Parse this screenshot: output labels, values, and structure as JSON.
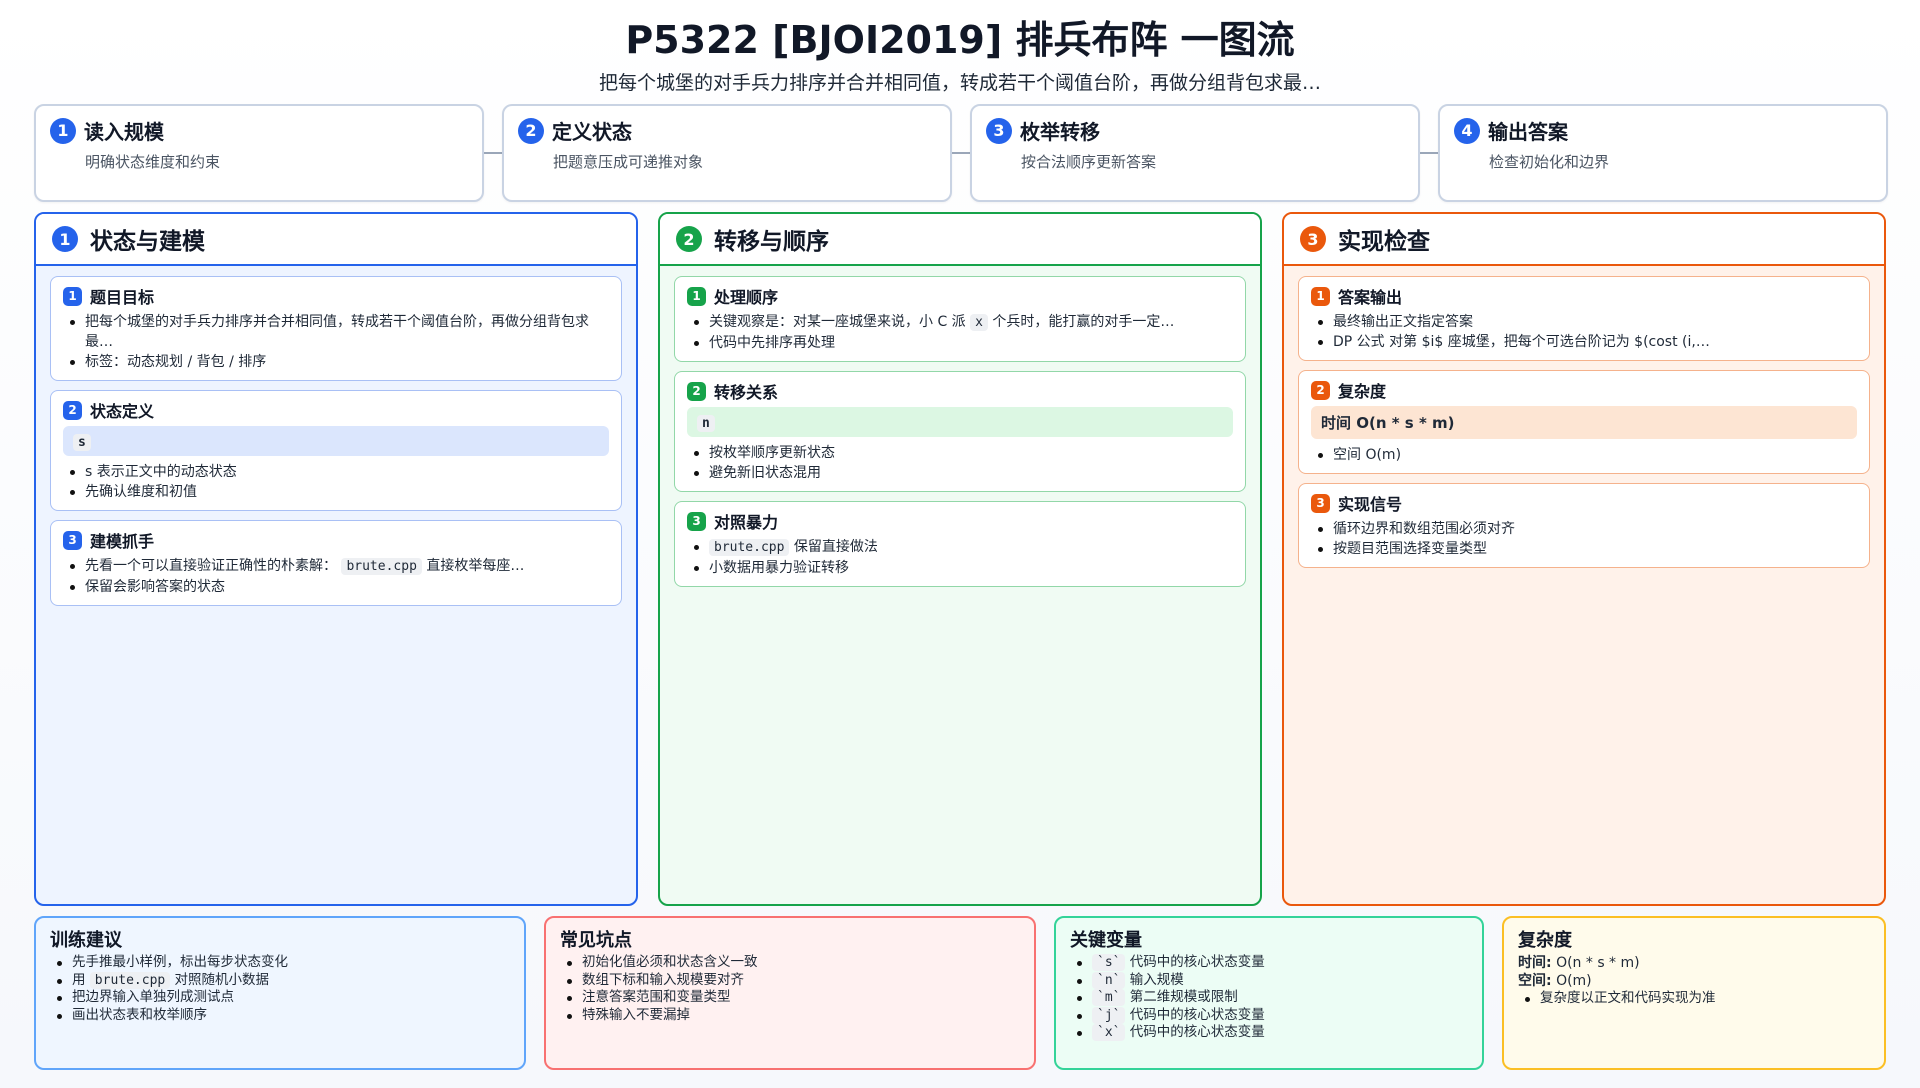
{
  "header": {
    "title": "P5322 [BJOI2019] 排兵布阵 一图流",
    "subtitle": "把每个城堡的对手兵力排序并合并相同值，转成若干个阈值台阶，再做分组背包求最…"
  },
  "steps": [
    {
      "num": "1",
      "title": "读入规模",
      "desc": "明确状态维度和约束"
    },
    {
      "num": "2",
      "title": "定义状态",
      "desc": "把题意压成可递推对象"
    },
    {
      "num": "3",
      "title": "枚举转移",
      "desc": "按合法顺序更新答案"
    },
    {
      "num": "4",
      "title": "输出答案",
      "desc": "检查初始化和边界"
    }
  ],
  "columns": {
    "model": {
      "num": "1",
      "title": "状态与建模",
      "cards": {
        "goal": {
          "num": "1",
          "title": "题目目标",
          "items": [
            "把每个城堡的对手兵力排序并合并相同值，转成若干个阈值台阶，再做分组背包求最…",
            "标签：动态规划 / 背包 / 排序"
          ]
        },
        "state": {
          "num": "2",
          "title": "状态定义",
          "highlight": "s",
          "items": [
            "s 表示正文中的动态状态",
            "先确认维度和初值"
          ]
        },
        "grip": {
          "num": "3",
          "title": "建模抓手",
          "item1_pre": "先看一个可以直接验证正确性的朴素解：",
          "item1_code": "brute.cpp",
          "item1_post": "直接枚举每座…",
          "item2": "保留会影响答案的状态"
        }
      }
    },
    "transition": {
      "num": "2",
      "title": "转移与顺序",
      "cards": {
        "order": {
          "num": "1",
          "title": "处理顺序",
          "item1_pre": "关键观察是：对某一座城堡来说，小 C 派",
          "item1_code": "x",
          "item1_post": "个兵时，能打赢的对手一定…",
          "item2": "代码中先排序再处理"
        },
        "relation": {
          "num": "2",
          "title": "转移关系",
          "highlight": "n",
          "items": [
            "按枚举顺序更新状态",
            "避免新旧状态混用"
          ]
        },
        "brute": {
          "num": "3",
          "title": "对照暴力",
          "item1_code": "brute.cpp",
          "item1_post": "保留直接做法",
          "item2": "小数据用暴力验证转移"
        }
      }
    },
    "impl": {
      "num": "3",
      "title": "实现检查",
      "cards": {
        "output": {
          "num": "1",
          "title": "答案输出",
          "items": [
            "最终输出正文指定答案",
            "DP 公式 对第 $i$ 座城堡，把每个可选台阶记为 $(cost (i,…"
          ]
        },
        "complexity": {
          "num": "2",
          "title": "复杂度",
          "highlight": "时间 O(n * s * m)",
          "items": [
            "空间 O(m)"
          ]
        },
        "signals": {
          "num": "3",
          "title": "实现信号",
          "items": [
            "循环边界和数组范围必须对齐",
            "按题目范围选择变量类型"
          ]
        }
      }
    }
  },
  "bottom": {
    "training": {
      "title": "训练建议",
      "item1": "先手推最小样例，标出每步状态变化",
      "item2_pre": "用",
      "item2_code": "brute.cpp",
      "item2_post": "对照随机小数据",
      "item3": "把边界输入单独列成测试点",
      "item4": "画出状态表和枚举顺序"
    },
    "pitfalls": {
      "title": "常见坑点",
      "items": [
        "初始化值必须和状态含义一致",
        "数组下标和输入规模要对齐",
        "注意答案范围和变量类型",
        "特殊输入不要漏掉"
      ]
    },
    "variables": {
      "title": "关键变量",
      "items": [
        {
          "code": "`s`",
          "desc": "代码中的核心状态变量"
        },
        {
          "code": "`n`",
          "desc": "输入规模"
        },
        {
          "code": "`m`",
          "desc": "第二维规模或限制"
        },
        {
          "code": "`j`",
          "desc": "代码中的核心状态变量"
        },
        {
          "code": "`x`",
          "desc": "代码中的核心状态变量"
        }
      ]
    },
    "complexity": {
      "title": "复杂度",
      "time_label": "时间:",
      "time_value": "O(n * s * m)",
      "space_label": "空间:",
      "space_value": "O(m)",
      "note": "复杂度以正文和代码实现为准"
    }
  },
  "colors": {
    "blue": "#2563eb",
    "green": "#16a34a",
    "orange": "#ea580c"
  }
}
